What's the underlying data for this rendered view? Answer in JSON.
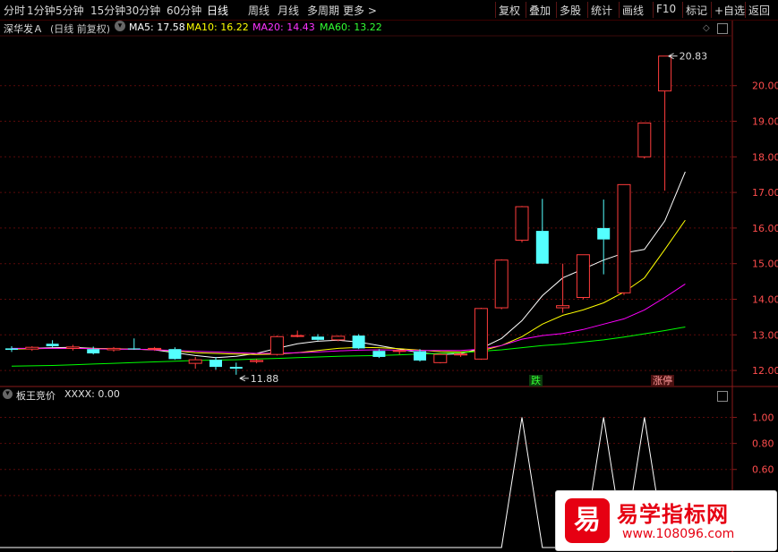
{
  "toolbar": {
    "periods": [
      "分时",
      "1分钟",
      "5分钟",
      "15分钟",
      "30分钟",
      "60分钟",
      "日线",
      "周线",
      "月线",
      "多周期",
      "更多 >"
    ],
    "active_period": "日线",
    "right_buttons": [
      "复权",
      "叠加",
      "多股",
      "统计",
      "画线",
      "F10",
      "标记",
      "+自选",
      "返回"
    ]
  },
  "stock": {
    "name": "深华发Ａ",
    "mode": "(日线 前复权)",
    "ma5_label": "MA5: 17.58",
    "ma10_label": "MA10: 16.22",
    "ma20_label": "MA20: 14.43",
    "ma60_label": "MA60: 13.22",
    "high_marker": "20.83",
    "low_marker": "11.88"
  },
  "signals": {
    "first": "跌",
    "second": "涨停"
  },
  "indicator": {
    "name": "板王竞价",
    "value_label": "XXXX: 0.00"
  },
  "colors": {
    "up": "#ff3c3c",
    "down": "#54ffff",
    "ma5": "#ffffff",
    "ma10": "#ffff00",
    "ma20": "#ff00ff",
    "ma60": "#00ff00",
    "axis_text": "#ff4d4d",
    "grid": "#5a0a0a"
  },
  "chart_data": [
    {
      "type": "candlestick",
      "title": "深华发Ａ (日线 前复权)",
      "ylim": [
        11.6,
        21.4
      ],
      "y_ticks": [
        12.0,
        13.0,
        14.0,
        15.0,
        16.0,
        17.0,
        18.0,
        19.0,
        20.0
      ],
      "candles": [
        {
          "o": 12.62,
          "h": 12.68,
          "l": 12.52,
          "c": 12.58
        },
        {
          "o": 12.6,
          "h": 12.68,
          "l": 12.55,
          "c": 12.65
        },
        {
          "o": 12.75,
          "h": 12.85,
          "l": 12.65,
          "c": 12.68
        },
        {
          "o": 12.62,
          "h": 12.72,
          "l": 12.56,
          "c": 12.66
        },
        {
          "o": 12.6,
          "h": 12.67,
          "l": 12.45,
          "c": 12.48
        },
        {
          "o": 12.58,
          "h": 12.66,
          "l": 12.53,
          "c": 12.62
        },
        {
          "o": 12.62,
          "h": 12.9,
          "l": 12.58,
          "c": 12.6
        },
        {
          "o": 12.6,
          "h": 12.66,
          "l": 12.55,
          "c": 12.62
        },
        {
          "o": 12.6,
          "h": 12.65,
          "l": 12.3,
          "c": 12.32
        },
        {
          "o": 12.2,
          "h": 12.38,
          "l": 12.05,
          "c": 12.3
        },
        {
          "o": 12.3,
          "h": 12.38,
          "l": 12.02,
          "c": 12.1
        },
        {
          "o": 12.1,
          "h": 12.22,
          "l": 11.88,
          "c": 12.05
        },
        {
          "o": 12.25,
          "h": 12.32,
          "l": 12.2,
          "c": 12.28
        },
        {
          "o": 12.45,
          "h": 12.98,
          "l": 12.42,
          "c": 12.95
        },
        {
          "o": 12.96,
          "h": 13.12,
          "l": 12.93,
          "c": 12.98
        },
        {
          "o": 12.95,
          "h": 13.02,
          "l": 12.84,
          "c": 12.86
        },
        {
          "o": 12.86,
          "h": 12.98,
          "l": 12.82,
          "c": 12.96
        },
        {
          "o": 12.98,
          "h": 13.02,
          "l": 12.6,
          "c": 12.62
        },
        {
          "o": 12.55,
          "h": 12.6,
          "l": 12.35,
          "c": 12.38
        },
        {
          "o": 12.55,
          "h": 12.58,
          "l": 12.45,
          "c": 12.56
        },
        {
          "o": 12.54,
          "h": 12.6,
          "l": 12.25,
          "c": 12.28
        },
        {
          "o": 12.22,
          "h": 12.48,
          "l": 12.2,
          "c": 12.45
        },
        {
          "o": 12.45,
          "h": 12.52,
          "l": 12.38,
          "c": 12.46
        },
        {
          "o": 12.32,
          "h": 13.76,
          "l": 12.3,
          "c": 13.74
        },
        {
          "o": 13.76,
          "h": 15.12,
          "l": 13.72,
          "c": 15.1
        },
        {
          "o": 15.66,
          "h": 16.62,
          "l": 15.6,
          "c": 16.6
        },
        {
          "o": 15.92,
          "h": 16.82,
          "l": 15.0,
          "c": 15.0
        },
        {
          "o": 13.76,
          "h": 15.0,
          "l": 13.62,
          "c": 13.82
        },
        {
          "o": 14.05,
          "h": 15.25,
          "l": 14.0,
          "c": 15.25
        },
        {
          "o": 16.0,
          "h": 16.8,
          "l": 14.7,
          "c": 15.68
        },
        {
          "o": 14.18,
          "h": 17.22,
          "l": 14.12,
          "c": 17.22
        },
        {
          "o": 18.0,
          "h": 18.95,
          "l": 17.95,
          "c": 18.95
        },
        {
          "o": 19.85,
          "h": 20.83,
          "l": 17.05,
          "c": 20.83
        }
      ],
      "ma": {
        "MA5": [
          12.6,
          12.62,
          12.64,
          12.65,
          12.62,
          12.6,
          12.6,
          12.58,
          12.5,
          12.42,
          12.36,
          12.4,
          12.48,
          12.62,
          12.75,
          12.82,
          12.85,
          12.8,
          12.7,
          12.6,
          12.5,
          12.45,
          12.47,
          12.62,
          12.9,
          13.4,
          14.1,
          14.6,
          14.85,
          15.1,
          15.3,
          15.4,
          16.2,
          17.58
        ],
        "MA10": [
          12.6,
          12.61,
          12.62,
          12.62,
          12.62,
          12.61,
          12.6,
          12.58,
          12.55,
          12.5,
          12.48,
          12.46,
          12.45,
          12.46,
          12.5,
          12.56,
          12.62,
          12.65,
          12.64,
          12.61,
          12.57,
          12.53,
          12.52,
          12.55,
          12.7,
          12.95,
          13.3,
          13.55,
          13.7,
          13.9,
          14.2,
          14.6,
          15.4,
          16.22
        ],
        "MA20": [
          12.62,
          12.62,
          12.62,
          12.62,
          12.61,
          12.6,
          12.6,
          12.58,
          12.56,
          12.54,
          12.52,
          12.5,
          12.48,
          12.48,
          12.5,
          12.52,
          12.55,
          12.57,
          12.58,
          12.57,
          12.56,
          12.56,
          12.56,
          12.6,
          12.7,
          12.88,
          12.98,
          13.04,
          13.15,
          13.3,
          13.45,
          13.7,
          14.05,
          14.43
        ],
        "MA60": [
          12.12,
          12.13,
          12.14,
          12.16,
          12.18,
          12.2,
          12.22,
          12.24,
          12.26,
          12.28,
          12.29,
          12.3,
          12.32,
          12.34,
          12.36,
          12.38,
          12.4,
          12.41,
          12.42,
          12.44,
          12.46,
          12.48,
          12.5,
          12.54,
          12.58,
          12.64,
          12.7,
          12.74,
          12.8,
          12.86,
          12.94,
          13.03,
          13.12,
          13.22
        ]
      }
    },
    {
      "type": "line",
      "title": "板王竞价",
      "ylim": [
        0,
        1.1
      ],
      "y_ticks": [
        0.4,
        0.6,
        0.8,
        1.0
      ],
      "series": [
        {
          "name": "XXXX",
          "values": [
            0,
            0,
            0,
            0,
            0,
            0,
            0,
            0,
            0,
            0,
            0,
            0,
            0,
            0,
            0,
            0,
            0,
            0,
            0,
            0,
            0,
            0,
            0,
            0,
            0,
            1,
            0,
            0,
            0,
            1,
            0,
            1,
            0,
            0
          ]
        }
      ]
    }
  ]
}
